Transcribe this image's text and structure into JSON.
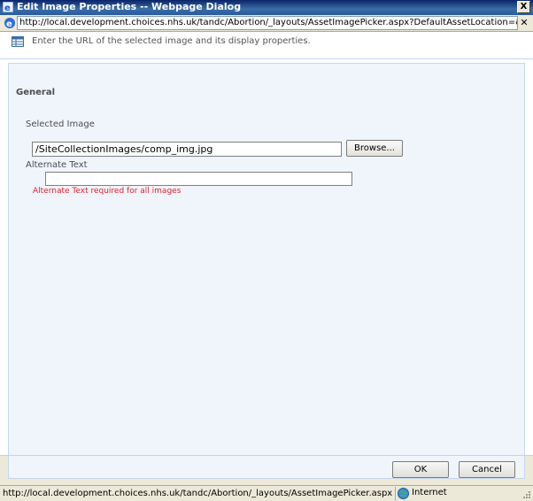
{
  "window": {
    "title": "Edit Image Properties -- Webpage Dialog",
    "close_glyph": "X"
  },
  "address": {
    "url": "http://local.development.choices.nhs.uk/tandc/Abortion/_layouts/AssetImagePicker.aspx?DefaultAssetLocation=&DefaultAssetImageLocation=&",
    "close_glyph": "✕"
  },
  "header": {
    "description": "Enter the URL of the selected image and its display properties."
  },
  "form": {
    "section_title": "General",
    "selected_image_label": "Selected Image",
    "selected_image_value": "/SiteCollectionImages/comp_img.jpg",
    "browse_label": "Browse...",
    "alt_text_label": "Alternate Text",
    "alt_text_value": "",
    "alt_text_error": "Alternate Text required for all images"
  },
  "footer": {
    "ok_label": "OK",
    "cancel_label": "Cancel"
  },
  "status": {
    "url": "http://local.development.choices.nhs.uk/tandc/Abortion/_layouts/AssetImagePicker.aspx?DefaultAssetLocation=&",
    "zone": "Internet"
  },
  "colors": {
    "titlebar": "#0a246a",
    "panel_bg": "#f0f5fc",
    "error": "#e01e2c"
  },
  "icons": [
    "app-icon",
    "ie-icon",
    "table-icon",
    "globe-icon",
    "resize-grip-icon"
  ]
}
